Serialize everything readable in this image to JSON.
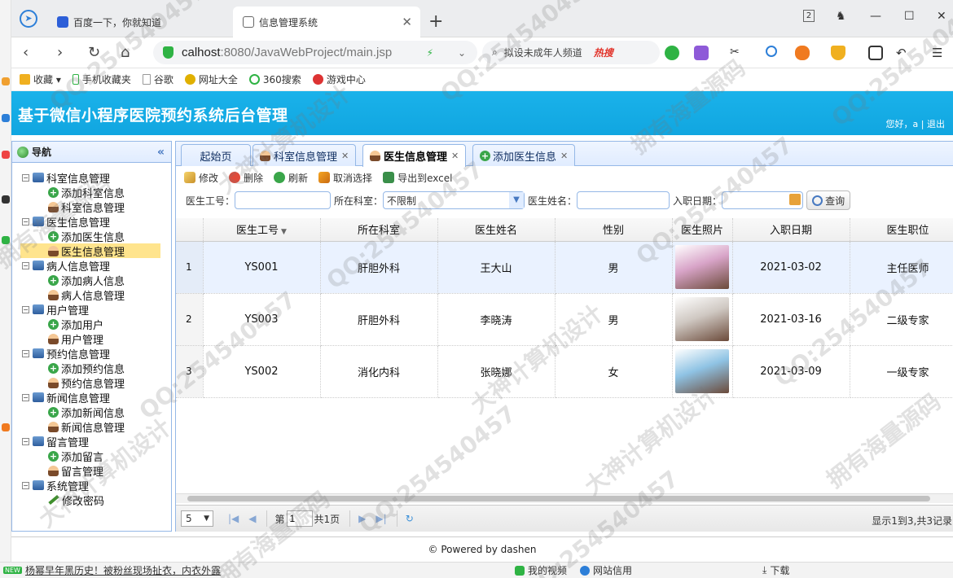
{
  "browser": {
    "tabs": [
      {
        "title": "百度一下，你就知道"
      },
      {
        "title": "信息管理系统"
      }
    ],
    "tab_count": "2",
    "url_host": "calhost",
    "url_path": ":8080/JavaWebProject/main.jsp",
    "search_placeholder": "拟设未成年人频道",
    "search_hot": "热搜",
    "bookmarks": [
      "收藏",
      "手机收藏夹",
      "谷歌",
      "网址大全",
      "360搜索",
      "游戏中心"
    ]
  },
  "app": {
    "title": "基于微信小程序医院预约系统后台管理",
    "greeting": "您好，a |",
    "logout": "退出"
  },
  "nav": {
    "title": "导航",
    "groups": [
      {
        "label": "科室信息管理",
        "children": [
          "添加科室信息",
          "科室信息管理"
        ]
      },
      {
        "label": "医生信息管理",
        "children": [
          "添加医生信息",
          "医生信息管理"
        ]
      },
      {
        "label": "病人信息管理",
        "children": [
          "添加病人信息",
          "病人信息管理"
        ]
      },
      {
        "label": "用户管理",
        "children": [
          "添加用户",
          "用户管理"
        ]
      },
      {
        "label": "预约信息管理",
        "children": [
          "添加预约信息",
          "预约信息管理"
        ]
      },
      {
        "label": "新闻信息管理",
        "children": [
          "添加新闻信息",
          "新闻信息管理"
        ]
      },
      {
        "label": "留言管理",
        "children": [
          "添加留言",
          "留言管理"
        ]
      },
      {
        "label": "系统管理",
        "children": [
          "修改密码"
        ]
      }
    ],
    "selected": "医生信息管理"
  },
  "content_tabs": [
    "起始页",
    "科室信息管理",
    "医生信息管理",
    "添加医生信息"
  ],
  "toolbar": [
    "修改",
    "删除",
    "刷新",
    "取消选择",
    "导出到excel"
  ],
  "filters": {
    "doctor_no_label": "医生工号：",
    "dept_label": "所在科室：",
    "dept_value": "不限制",
    "name_label": "医生姓名：",
    "date_label": "入职日期：",
    "query": "查询"
  },
  "grid": {
    "columns": [
      "医生工号",
      "所在科室",
      "医生姓名",
      "性别",
      "医生照片",
      "入职日期",
      "医生职位"
    ],
    "rows": [
      {
        "n": "1",
        "no": "YS001",
        "dept": "肝胆外科",
        "name": "王大山",
        "sex": "男",
        "date": "2021-03-02",
        "title": "主任医师",
        "photo": "#d8a4c8"
      },
      {
        "n": "2",
        "no": "YS003",
        "dept": "肝胆外科",
        "name": "李晓涛",
        "sex": "男",
        "date": "2021-03-16",
        "title": "二级专家",
        "photo": "#cfc8c2"
      },
      {
        "n": "3",
        "no": "YS002",
        "dept": "消化内科",
        "name": "张晓娜",
        "sex": "女",
        "date": "2021-03-09",
        "title": "一级专家",
        "photo": "#8fc3e4"
      }
    ]
  },
  "pager": {
    "page_size": "5",
    "page_label": "第",
    "page_value": "1",
    "total_label": "共1页",
    "info": "显示1到3,共3记录"
  },
  "footer": "© Powered by dashen",
  "status": {
    "new": "NEW",
    "news": "杨幂早年黑历史！被粉丝现场扯衣，内衣外露",
    "items": [
      "我的视频",
      "网站信用",
      "下载"
    ]
  },
  "watermarks": [
    "QQ:254540457",
    "大神计算机设计",
    "拥有海量源码"
  ],
  "colors": {
    "header": "#11a6e0",
    "border": "#95b8e7",
    "selected": "#ffe48d"
  }
}
